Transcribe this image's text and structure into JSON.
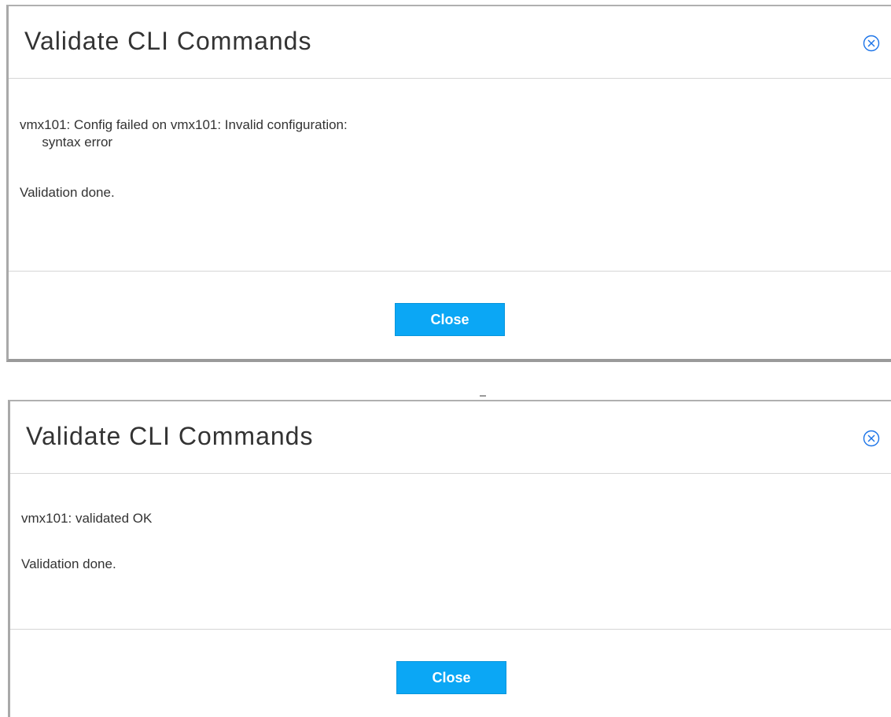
{
  "dialogs": [
    {
      "title": "Validate CLI Commands",
      "messages": [
        "vmx101: Config failed on vmx101: Invalid configuration:",
        "      syntax error",
        "Validation done."
      ],
      "close_label": "Close",
      "close_icon": "circle-x-icon"
    },
    {
      "title": "Validate CLI Commands",
      "messages": [
        "vmx101: validated OK",
        "Validation done."
      ],
      "close_label": "Close",
      "close_icon": "circle-x-icon"
    }
  ],
  "colors": {
    "button_bg": "#0ba7f5",
    "button_text": "#ffffff",
    "icon": "#1a73e8",
    "divider": "#d6d6d6"
  }
}
